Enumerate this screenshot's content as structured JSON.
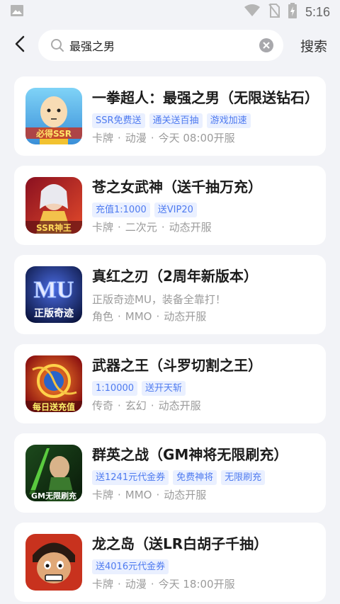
{
  "status_bar": {
    "time": "5:16",
    "icons": [
      "image-icon",
      "wifi-icon",
      "no-sim-icon",
      "battery-charging-icon"
    ]
  },
  "header": {
    "search_value": "最强之男",
    "search_button": "搜索"
  },
  "colors": {
    "accent_blue": "#4f7bf0",
    "tag_bg": "#eaf0ff",
    "meta_gray": "#9b9b9b",
    "page_bg": "#f2f3f7"
  },
  "results": [
    {
      "title": "一拳超人：最强之男（无限送钻石）",
      "tags": [
        "SSR免费送",
        "通关送百抽",
        "游戏加速"
      ],
      "desc": "",
      "meta": [
        "卡牌",
        "动漫",
        "今天 08:00开服"
      ],
      "icon_name": "one-punch-man-game-icon",
      "icon_caption": "必得SSR"
    },
    {
      "title": "苍之女武神（送千抽万充）",
      "tags": [
        "充值1:1000",
        "送VIP20"
      ],
      "desc": "",
      "meta": [
        "卡牌",
        "二次元",
        "动态开服"
      ],
      "icon_name": "valkyrie-game-icon",
      "icon_caption": "SSR神王"
    },
    {
      "title": "真红之刃（2周年新版本）",
      "tags": [],
      "desc": "正版奇迹MU，装备全靠打！",
      "meta": [
        "角色",
        "MMO",
        "动态开服"
      ],
      "icon_name": "mu-game-icon",
      "icon_caption": "正版奇迹"
    },
    {
      "title": "武器之王（斗罗切割之王）",
      "tags": [
        "1:10000",
        "送开天斩"
      ],
      "desc": "",
      "meta": [
        "传奇",
        "玄幻",
        "动态开服"
      ],
      "icon_name": "weapon-king-game-icon",
      "icon_caption": "每日送充值"
    },
    {
      "title": "群英之战（GM神将无限刷充）",
      "tags": [
        "送1241元代金券",
        "免费神将",
        "无限刷充"
      ],
      "desc": "",
      "meta": [
        "卡牌",
        "MMO",
        "动态开服"
      ],
      "icon_name": "heroes-war-game-icon",
      "icon_caption": "GM无限刷充"
    },
    {
      "title": "龙之岛（送LR白胡子千抽）",
      "tags": [
        "送4016元代金券"
      ],
      "desc": "",
      "meta": [
        "卡牌",
        "动漫",
        "今天 18:00开服"
      ],
      "icon_name": "dragon-island-game-icon",
      "icon_caption": ""
    }
  ]
}
